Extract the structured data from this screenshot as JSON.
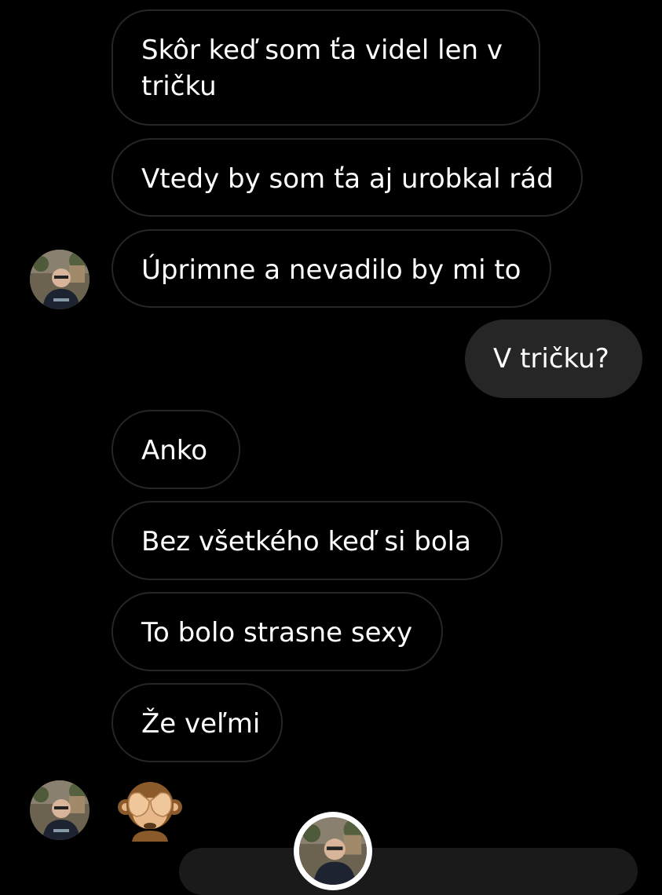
{
  "messages": [
    {
      "text": "Skôr keď som ťa videl len v tričku",
      "direction": "incoming"
    },
    {
      "text": "Vtedy by som ťa aj urobkal rád",
      "direction": "incoming"
    },
    {
      "text": "Úprimne a nevadilo by mi to",
      "direction": "incoming"
    },
    {
      "text": "V tričku?",
      "direction": "outgoing"
    },
    {
      "text": "Anko",
      "direction": "incoming"
    },
    {
      "text": "Bez všetkého keď si bola",
      "direction": "incoming"
    },
    {
      "text": "To bolo strasne sexy",
      "direction": "incoming"
    },
    {
      "text": "Že veľmi",
      "direction": "incoming"
    },
    {
      "text": "🙈",
      "direction": "incoming",
      "kind": "emoji"
    }
  ],
  "colors": {
    "background": "#000000",
    "incoming_border": "#262626",
    "outgoing_bubble": "#262626",
    "text": "#ffffff"
  },
  "icons": {
    "contact_avatar": "profile-photo",
    "emoji": "see-no-evil-monkey"
  }
}
